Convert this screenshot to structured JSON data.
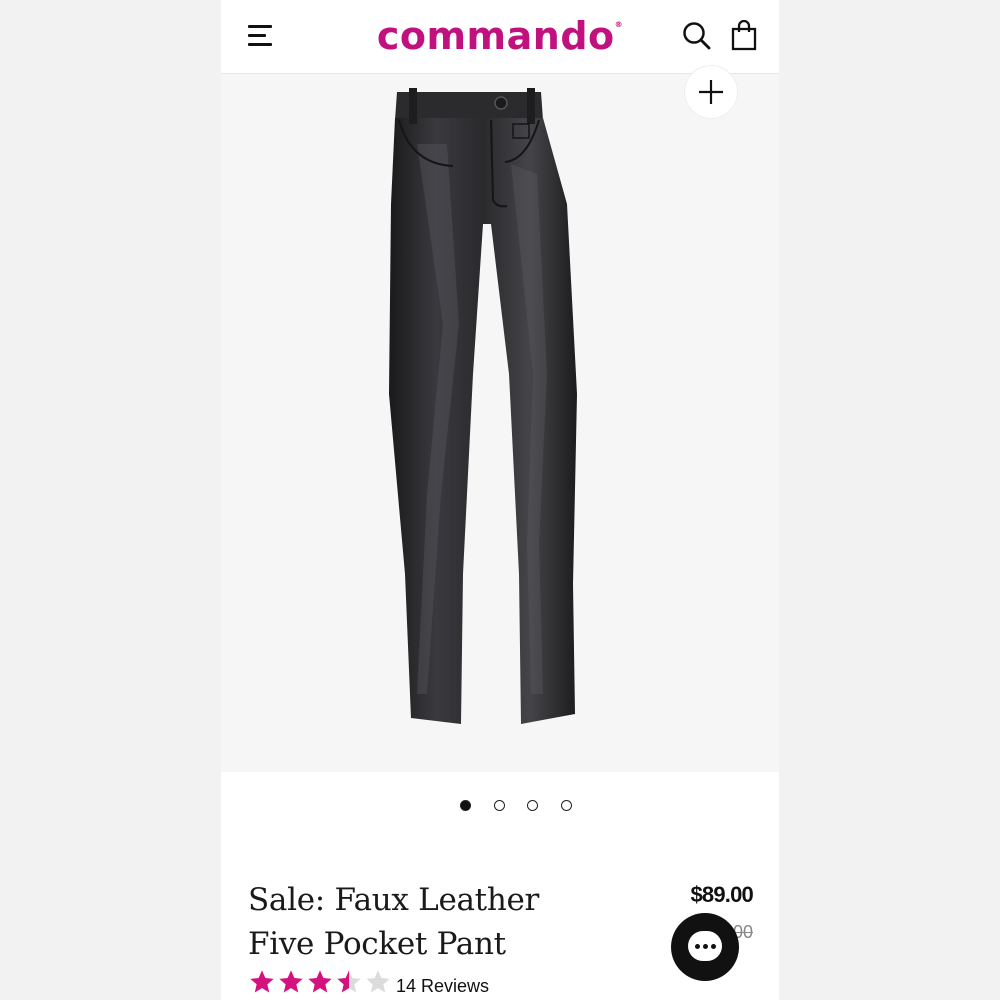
{
  "header": {
    "brand": "commando",
    "brand_mark": "®",
    "icons": [
      "menu-icon",
      "search-icon",
      "shopping-bag-icon"
    ]
  },
  "gallery": {
    "image_subject": "black faux leather five pocket pant",
    "zoom_icon": "plus-icon",
    "slide_count": 4,
    "active_slide": 1
  },
  "product": {
    "title": "Sale: Faux Leather Five Pocket Pant",
    "price": "$89.00",
    "old_price_visible_fragment": "00",
    "rating": 3.5,
    "rating_max": 5,
    "reviews": "14 Reviews"
  },
  "chat": {
    "icon": "chat-bubble-icon"
  },
  "colors": {
    "brand": "#c0117e",
    "star_filled": "#d4127f",
    "star_empty": "#dcdcdc",
    "text": "#111111",
    "page_background": "#f2f2f2"
  }
}
